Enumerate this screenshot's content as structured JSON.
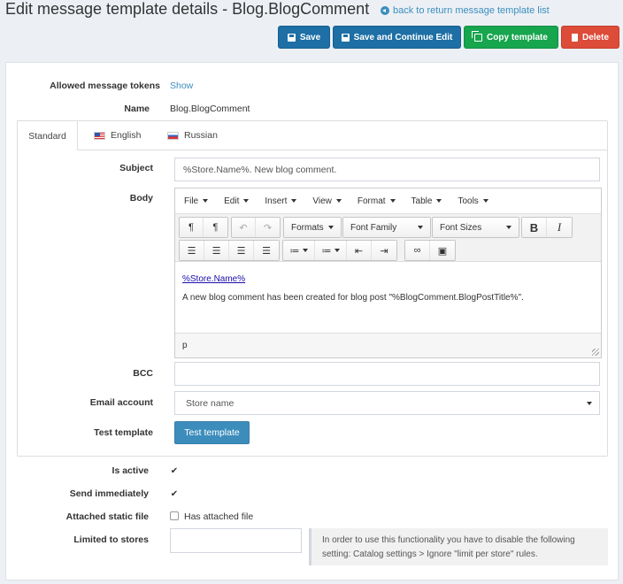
{
  "header": {
    "title": "Edit message template details - Blog.BlogComment",
    "back_link": "back to return message template list"
  },
  "actions": {
    "save": "Save",
    "save_continue": "Save and Continue Edit",
    "copy": "Copy template",
    "delete": "Delete"
  },
  "info": {
    "tokens_label": "Allowed message tokens",
    "tokens_link": "Show",
    "name_label": "Name",
    "name_value": "Blog.BlogComment"
  },
  "tabs": [
    {
      "label": "Standard",
      "active": true
    },
    {
      "label": "English",
      "flag": "us-flag-icon"
    },
    {
      "label": "Russian",
      "flag": "ru-flag-icon"
    }
  ],
  "form": {
    "subject_label": "Subject",
    "subject_value": "%Store.Name%. New blog comment.",
    "body_label": "Body",
    "bcc_label": "BCC",
    "bcc_value": "",
    "email_account_label": "Email account",
    "email_account_value": "Store name",
    "test_template_label": "Test template",
    "test_template_button": "Test template"
  },
  "editor": {
    "menus": [
      "File",
      "Edit",
      "Insert",
      "View",
      "Format",
      "Table",
      "Tools"
    ],
    "formats": "Formats",
    "font_family": "Font Family",
    "font_sizes": "Font Sizes",
    "bold": "B",
    "italic": "I",
    "content_link": "%Store.Name%",
    "content_text": "A new blog comment has been created for blog post \"%BlogComment.BlogPostTitle%\".",
    "status_path": "p"
  },
  "settings": {
    "is_active_label": "Is active",
    "is_active": true,
    "send_immediately_label": "Send immediately",
    "send_immediately": true,
    "attached_label": "Attached static file",
    "attached_checkbox_text": "Has attached file",
    "attached": false,
    "stores_label": "Limited to stores",
    "stores_note": "In order to use this functionality you have to disable the following setting: Catalog settings > Ignore \"limit per store\" rules."
  }
}
